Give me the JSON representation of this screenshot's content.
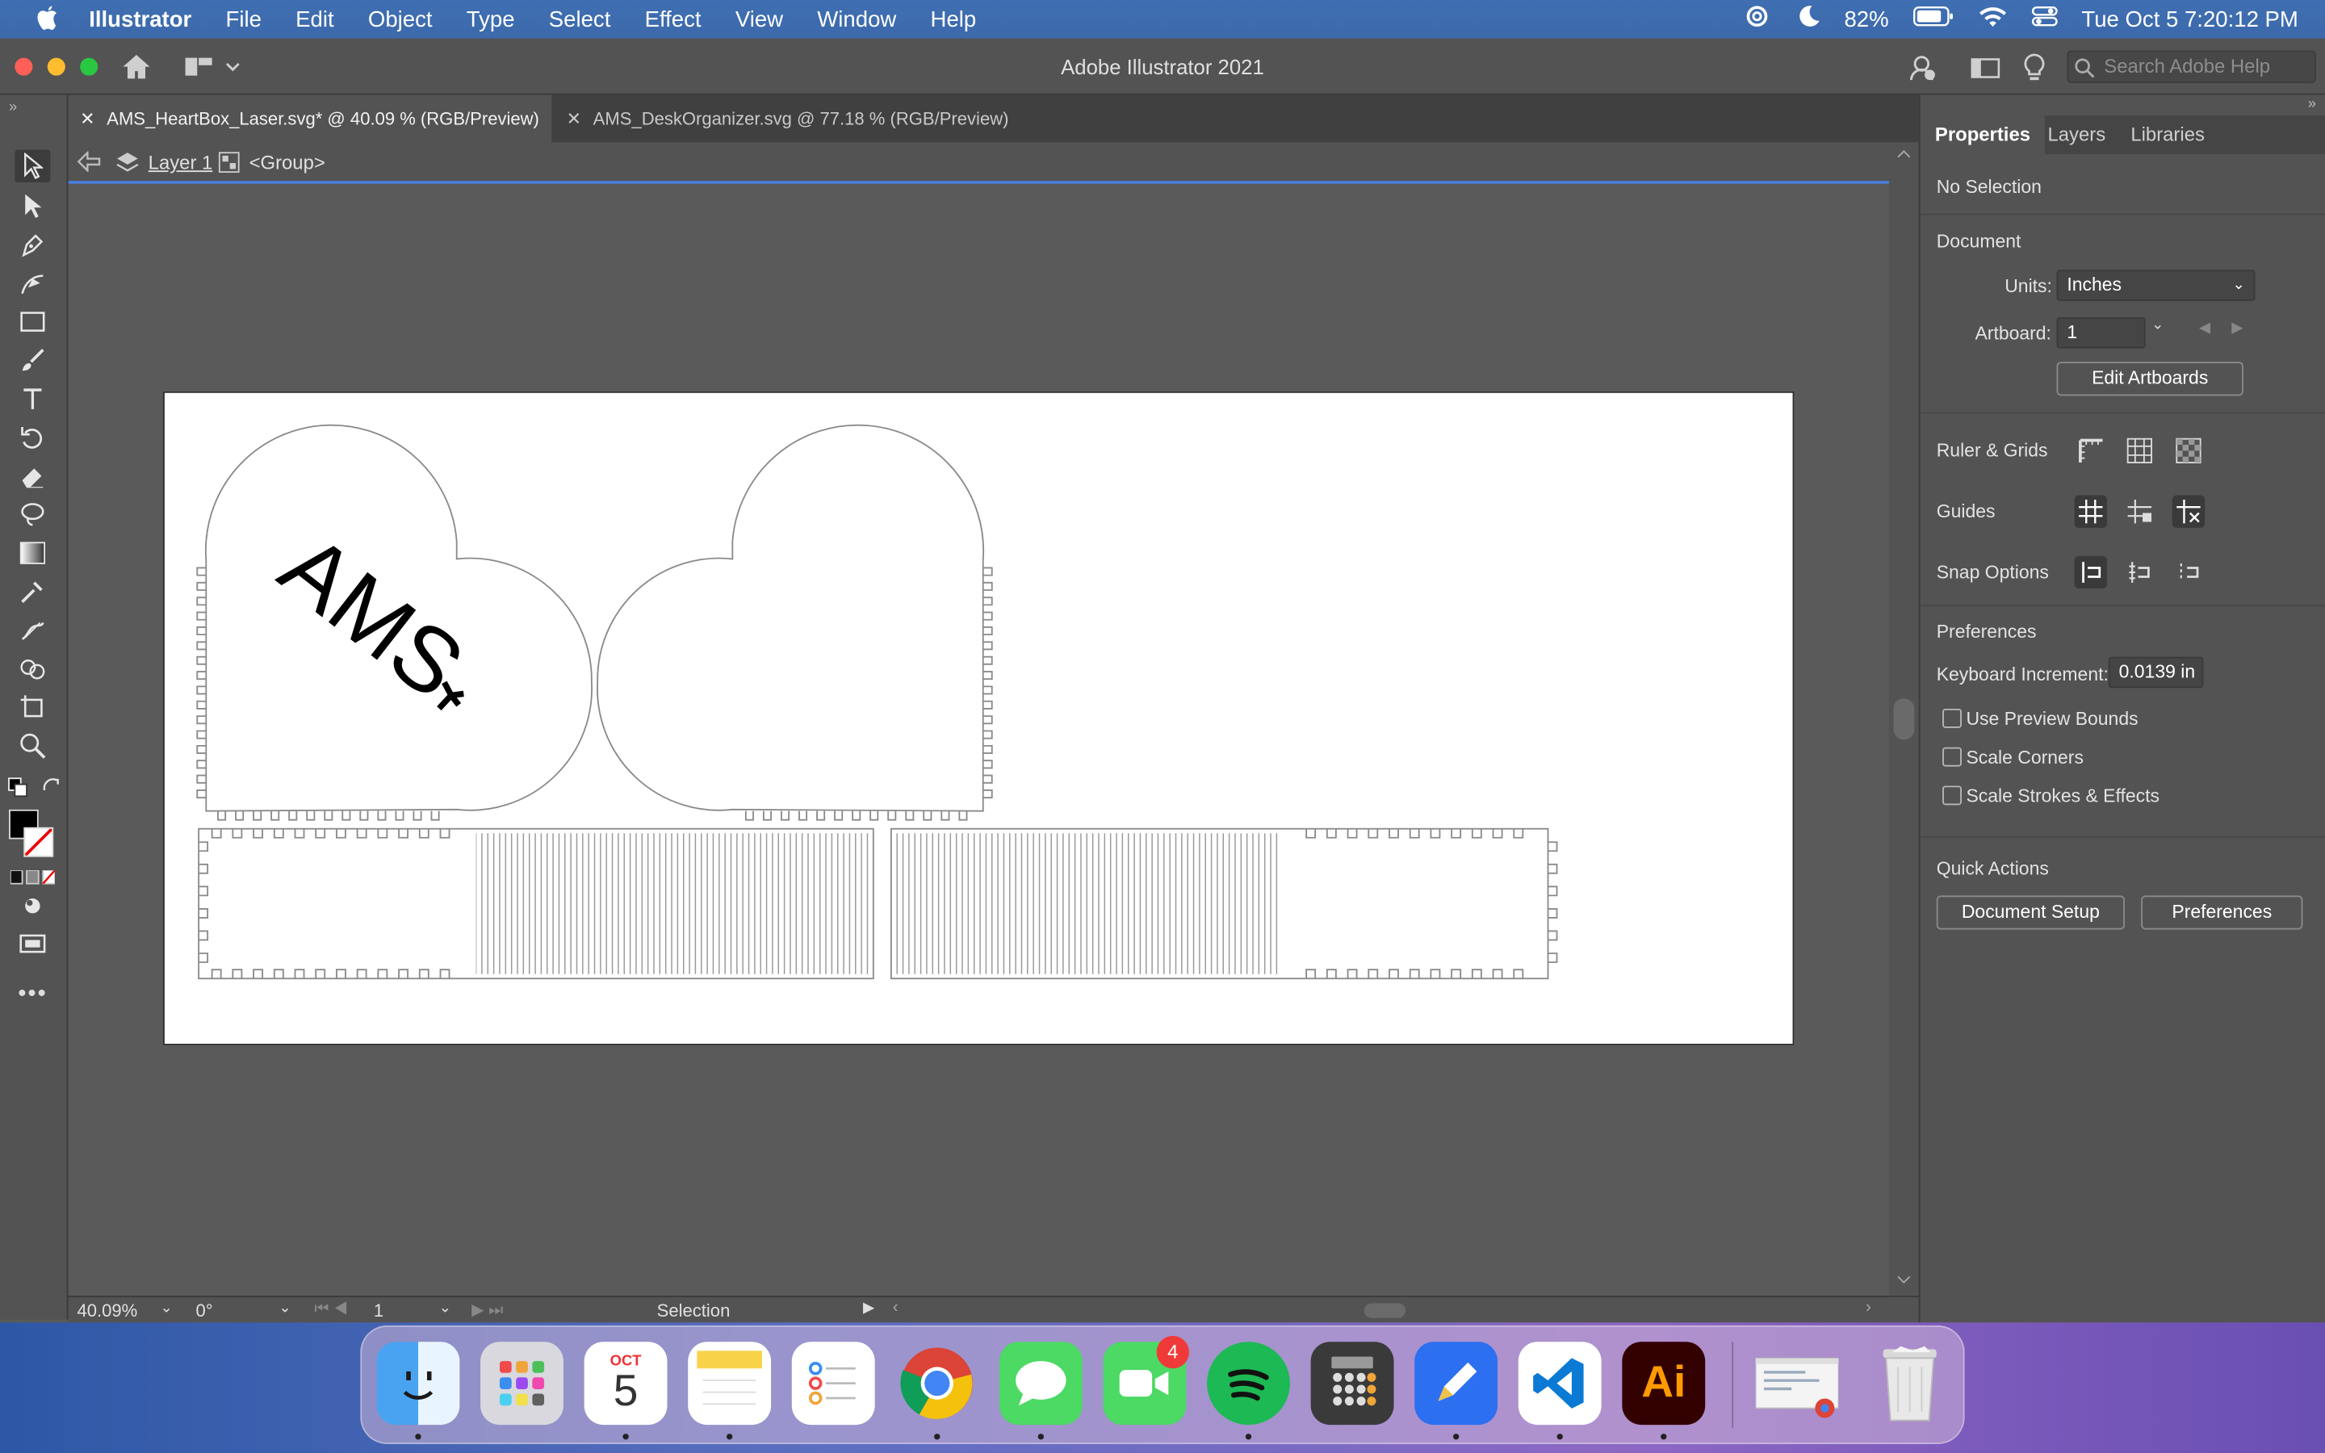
{
  "menubar": {
    "app_name": "Illustrator",
    "menus": [
      "File",
      "Edit",
      "Object",
      "Type",
      "Select",
      "Effect",
      "View",
      "Window",
      "Help"
    ],
    "battery": "82%",
    "clock": "Tue Oct 5  7:20:12 PM"
  },
  "window": {
    "title": "Adobe Illustrator 2021",
    "help_search_placeholder": "Search Adobe Help"
  },
  "tabs": [
    {
      "label": "AMS_HeartBox_Laser.svg* @ 40.09 % (RGB/Preview)",
      "active": true
    },
    {
      "label": "AMS_DeskOrganizer.svg @ 77.18 % (RGB/Preview)",
      "active": false
    }
  ],
  "breadcrumb": {
    "layer": "Layer 1",
    "group": "<Group>"
  },
  "artwork": {
    "engraved_text": "AMS"
  },
  "status": {
    "zoom": "40.09%",
    "rotation": "0°",
    "artboard": "1",
    "tool": "Selection"
  },
  "panel": {
    "tabs": [
      "Properties",
      "Layers",
      "Libraries"
    ],
    "selection": "No Selection",
    "document_heading": "Document",
    "units_label": "Units:",
    "units_value": "Inches",
    "artboard_label": "Artboard:",
    "artboard_value": "1",
    "edit_artboards": "Edit Artboards",
    "ruler_grids": "Ruler & Grids",
    "guides": "Guides",
    "snap_options": "Snap Options",
    "preferences_heading": "Preferences",
    "keyboard_increment_label": "Keyboard Increment:",
    "keyboard_increment_value": "0.0139 in",
    "checkboxes": [
      "Use Preview Bounds",
      "Scale Corners",
      "Scale Strokes & Effects"
    ],
    "quick_actions": "Quick Actions",
    "document_setup": "Document Setup",
    "preferences_button": "Preferences"
  },
  "dock": {
    "calendar_month": "OCT",
    "calendar_day": "5",
    "facetime_badge": "4",
    "illustrator_label": "Ai"
  },
  "colors": {
    "accent": "#4a7de0",
    "illustrator_bg": "#330000",
    "illustrator_fg": "#ff9a00"
  }
}
